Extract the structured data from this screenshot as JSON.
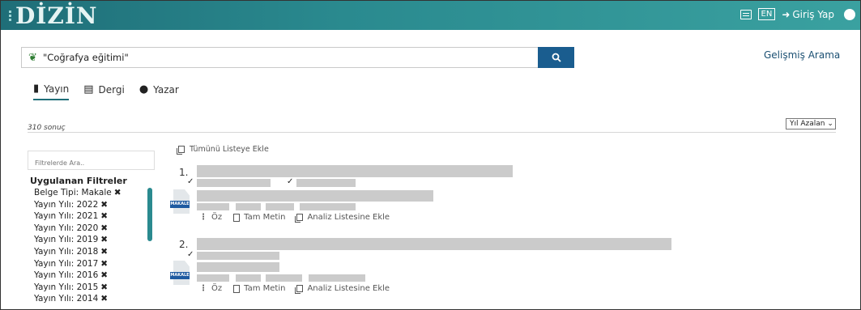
{
  "header": {
    "logo": "DİZİN",
    "language": "EN",
    "login_label": "Giriş Yap"
  },
  "search": {
    "query": "\"Coğrafya eğitimi\"",
    "advanced_label": "Gelişmiş Arama"
  },
  "tabs": [
    {
      "label": "Yayın",
      "icon": "file-icon",
      "active": true
    },
    {
      "label": "Dergi",
      "icon": "journal-icon",
      "active": false
    },
    {
      "label": "Yazar",
      "icon": "user-icon",
      "active": false
    }
  ],
  "results": {
    "count_label": "310 sonuç",
    "sort_label": "Yıl Azalan"
  },
  "sidebar": {
    "filter_placeholder": "Filtrelerde Ara..",
    "applied_title": "Uygulanan Filtreler",
    "filters": [
      "Belge Tipi: Makale",
      "Yayın Yılı: 2022",
      "Yayın Yılı: 2021",
      "Yayın Yılı: 2020",
      "Yayın Yılı: 2019",
      "Yayın Yılı: 2018",
      "Yayın Yılı: 2017",
      "Yayın Yılı: 2016",
      "Yayın Yılı: 2015",
      "Yayın Yılı: 2014"
    ],
    "remove_icon": "✖"
  },
  "list": {
    "add_all_label": "Tümünü Listeye Ekle",
    "items": [
      {
        "number": "1.",
        "doc_tag": "MAKALE"
      },
      {
        "number": "2.",
        "doc_tag": "MAKALE"
      }
    ],
    "actions": {
      "summary": "Öz",
      "full_text": "Tam Metin",
      "add_analysis": "Analiz Listesine Ekle"
    }
  },
  "colors": {
    "header": "#2a8a8f",
    "search_button": "#1a5d8f",
    "doc_tag": "#1e5aa0",
    "redacted": "#cbcbcb"
  }
}
